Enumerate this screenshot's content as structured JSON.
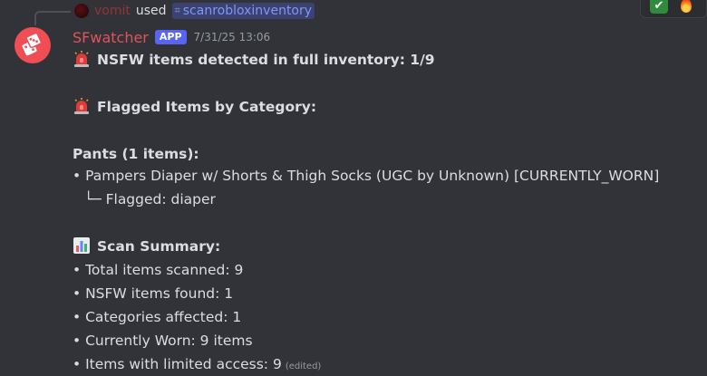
{
  "command": {
    "user": "vomit",
    "used": "used",
    "command_name": "scanrobloxinventory"
  },
  "message": {
    "author": "SFwatcher",
    "badge": "APP",
    "timestamp": "7/31/25 13:06",
    "headline": "NSFW items detected in full inventory: 1/9",
    "flagged_heading": "Flagged Items by Category:",
    "category_heading": "Pants (1 items):",
    "item_line": "• Pampers Diaper w/ Shorts & Thigh Socks (UGC by Unknown) [CURRENTLY_WORN]",
    "flag_line": "└─ Flagged: diaper",
    "summary_heading": "Scan Summary:",
    "summary_items": [
      "• Total items scanned: 9",
      "• NSFW items found: 1",
      "• Categories affected: 1",
      "• Currently Worn: 9 items",
      "• Items with limited access: 9"
    ],
    "edited": "(edited)"
  },
  "reactions": {
    "icons": [
      "check-icon",
      "fire-icon"
    ]
  },
  "colors": {
    "background": "#323339",
    "author": "#e0535a",
    "badge": "#5865f2",
    "command_tag_bg": "#3c4270",
    "command_tag_text": "#7f97f5"
  }
}
